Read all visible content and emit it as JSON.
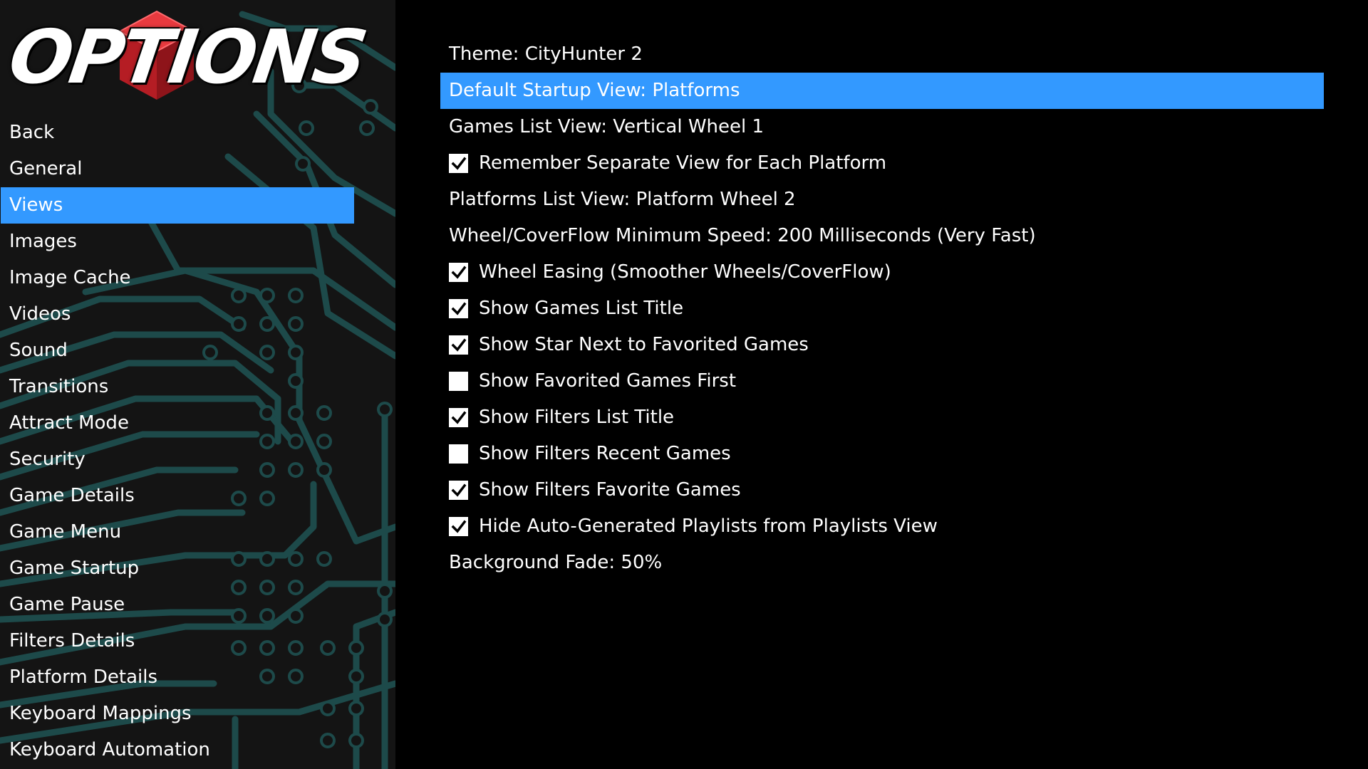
{
  "logo": {
    "text": "OPTIONS",
    "icon": "red-cube-icon",
    "colors": {
      "cube": "#d9242b",
      "text": "#ffffff"
    }
  },
  "sidebar": {
    "items": [
      {
        "label": "Back",
        "selected": false
      },
      {
        "label": "General",
        "selected": false
      },
      {
        "label": "Views",
        "selected": true
      },
      {
        "label": "Images",
        "selected": false
      },
      {
        "label": "Image Cache",
        "selected": false
      },
      {
        "label": "Videos",
        "selected": false
      },
      {
        "label": "Sound",
        "selected": false
      },
      {
        "label": "Transitions",
        "selected": false
      },
      {
        "label": "Attract Mode",
        "selected": false
      },
      {
        "label": "Security",
        "selected": false
      },
      {
        "label": "Game Details",
        "selected": false
      },
      {
        "label": "Game Menu",
        "selected": false
      },
      {
        "label": "Game Startup",
        "selected": false
      },
      {
        "label": "Game Pause",
        "selected": false
      },
      {
        "label": "Filters Details",
        "selected": false
      },
      {
        "label": "Platform Details",
        "selected": false
      },
      {
        "label": "Keyboard Mappings",
        "selected": false
      },
      {
        "label": "Keyboard Automation",
        "selected": false
      }
    ]
  },
  "settings": {
    "items": [
      {
        "label": "Theme: CityHunter 2",
        "type": "value",
        "selected": false
      },
      {
        "label": "Default Startup View: Platforms",
        "type": "value",
        "selected": true
      },
      {
        "label": "Games List View: Vertical Wheel 1",
        "type": "value",
        "selected": false
      },
      {
        "label": "Remember Separate View for Each Platform",
        "type": "checkbox",
        "checked": true,
        "selected": false
      },
      {
        "label": "Platforms List View: Platform Wheel 2",
        "type": "value",
        "selected": false
      },
      {
        "label": "Wheel/CoverFlow Minimum Speed: 200 Milliseconds (Very Fast)",
        "type": "value",
        "selected": false
      },
      {
        "label": "Wheel Easing (Smoother Wheels/CoverFlow)",
        "type": "checkbox",
        "checked": true,
        "selected": false
      },
      {
        "label": "Show Games List Title",
        "type": "checkbox",
        "checked": true,
        "selected": false
      },
      {
        "label": "Show Star Next to Favorited Games",
        "type": "checkbox",
        "checked": true,
        "selected": false
      },
      {
        "label": "Show Favorited Games First",
        "type": "checkbox",
        "checked": false,
        "selected": false
      },
      {
        "label": "Show Filters List Title",
        "type": "checkbox",
        "checked": true,
        "selected": false
      },
      {
        "label": "Show Filters Recent Games",
        "type": "checkbox",
        "checked": false,
        "selected": false
      },
      {
        "label": "Show Filters Favorite Games",
        "type": "checkbox",
        "checked": true,
        "selected": false
      },
      {
        "label": "Hide Auto-Generated Playlists from Playlists View",
        "type": "checkbox",
        "checked": true,
        "selected": false
      },
      {
        "label": "Background Fade: 50%",
        "type": "value",
        "selected": false
      }
    ]
  },
  "theme_colors": {
    "selection": "#3399ff",
    "sidebar_bg": "#141414",
    "circuit": "#1d4a4a",
    "main_bg": "#000000",
    "text": "#ffffff"
  }
}
